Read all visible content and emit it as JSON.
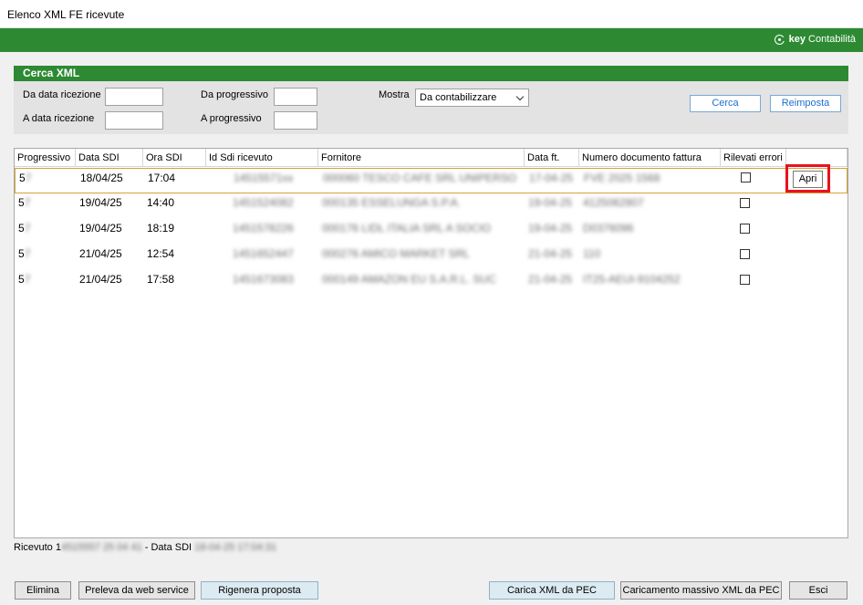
{
  "window": {
    "title": "Elenco XML FE ricevute"
  },
  "brand": {
    "key": "key",
    "name": "Contabilità",
    "icon": "keycontabilita-logo-icon"
  },
  "search": {
    "header": "Cerca XML",
    "from_date_label": "Da data ricezione",
    "to_date_label": "A data ricezione",
    "from_prog_label": "Da progressivo",
    "to_prog_label": "A progressivo",
    "mostra_label": "Mostra",
    "mostra_value": "Da contabilizzare",
    "from_date_value": "",
    "to_date_value": "",
    "from_prog_value": "",
    "to_prog_value": "",
    "cerca_label": "Cerca",
    "reimposta_label": "Reimposta"
  },
  "grid": {
    "columns": [
      "Progressivo",
      "Data SDI",
      "Ora SDI",
      "Id Sdi ricevuto",
      "Fornitore",
      "Data ft.",
      "Numero documento fattura",
      "Rilevati errori"
    ],
    "rows": [
      {
        "prog": "5",
        "prog_blur": "7",
        "data": "18/04/25",
        "ora": "17:04",
        "id": "14515571xx",
        "fornitore": "000060 TESCO CAFE SRL UNIPERSO",
        "data_ft": "17-04-25",
        "numero": "FVE 2025 1568",
        "errori": false
      },
      {
        "prog": "5",
        "prog_blur": "7",
        "data": "19/04/25",
        "ora": "14:40",
        "id": "1451524082",
        "fornitore": "000135 ESSELUNGA S.P.A.",
        "data_ft": "19-04-25",
        "numero": "4125062807",
        "errori": false
      },
      {
        "prog": "5",
        "prog_blur": "7",
        "data": "19/04/25",
        "ora": "18:19",
        "id": "1451578226",
        "fornitore": "000176 LIDL ITALIA SRL A SOCIO",
        "data_ft": "19-04-25",
        "numero": "D0376096",
        "errori": false
      },
      {
        "prog": "5",
        "prog_blur": "7",
        "data": "21/04/25",
        "ora": "12:54",
        "id": "1451652447",
        "fornitore": "000276 AMICO MARKET SRL",
        "data_ft": "21-04-25",
        "numero": "110",
        "errori": false
      },
      {
        "prog": "5",
        "prog_blur": "7",
        "data": "21/04/25",
        "ora": "17:58",
        "id": "1451673083",
        "fornitore": "000149 AMAZON EU S.A.R.L. SUC",
        "data_ft": "21-04-25",
        "numero": "IT25-AEUI-9104252",
        "errori": false
      }
    ],
    "apri_label": "Apri"
  },
  "status": {
    "ricevuto_label": "Ricevuto 1",
    "ricevuto_value": "4515557 25 04 41",
    "data_label": " - Data SDI",
    "data_value": "18-04-25 17:04:31"
  },
  "buttons": {
    "elimina": "Elimina",
    "preleva": "Preleva da web service",
    "rigenera": "Rigenera proposta",
    "carica": "Carica XML da PEC",
    "massivo": "Caricamento massivo XML da PEC",
    "esci": "Esci"
  }
}
